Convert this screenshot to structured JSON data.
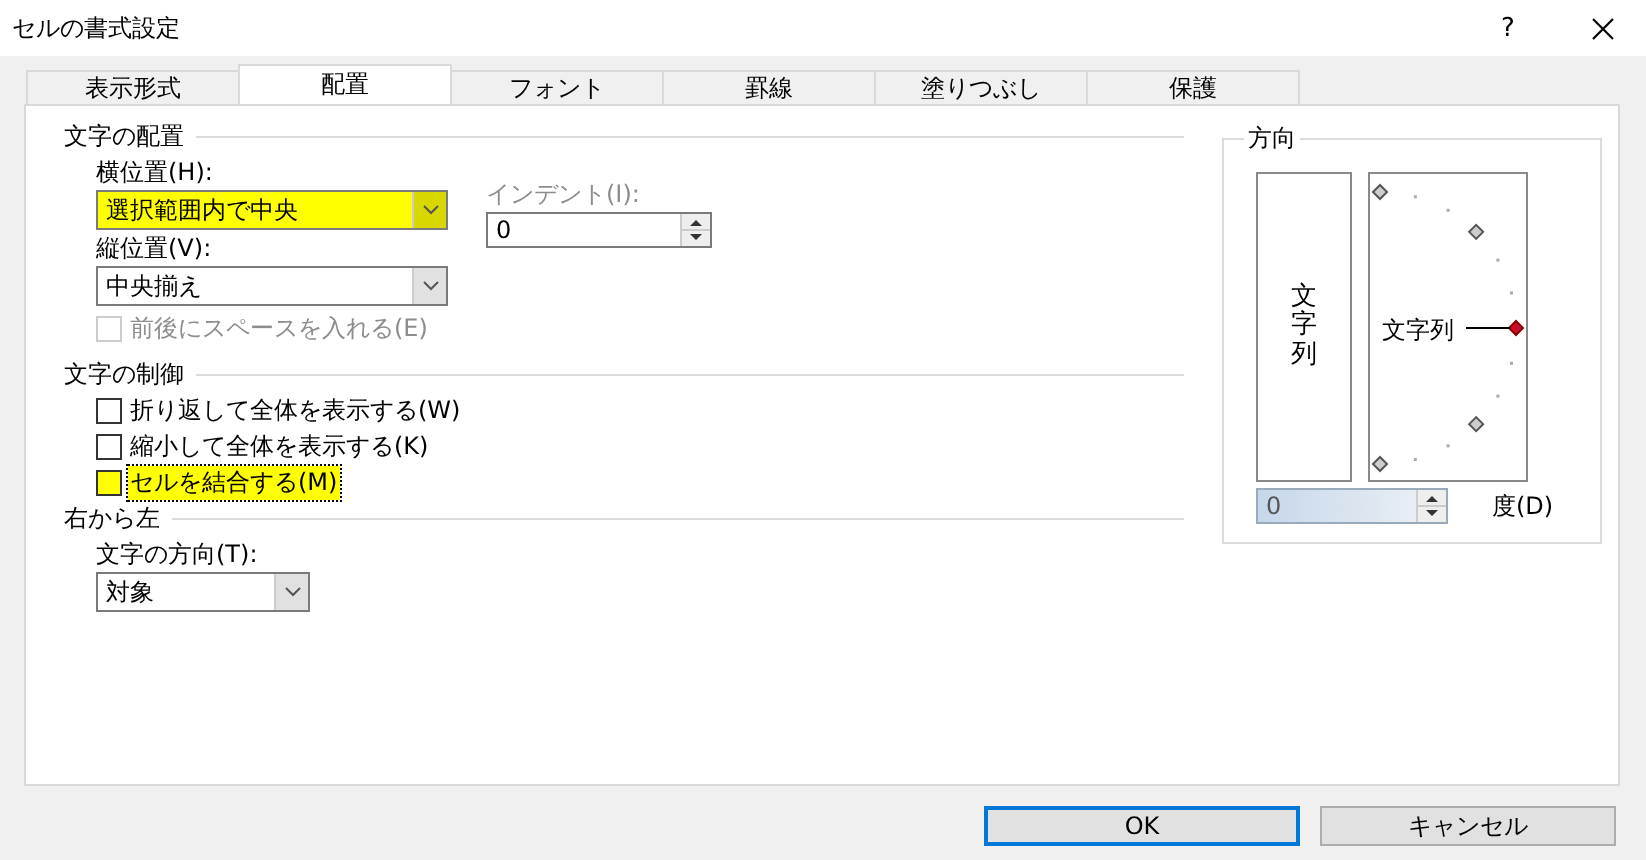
{
  "window": {
    "title": "セルの書式設定",
    "help": "?"
  },
  "tabs": [
    {
      "label": "表示形式",
      "selected": false
    },
    {
      "label": "配置",
      "selected": true
    },
    {
      "label": "フォント",
      "selected": false
    },
    {
      "label": "罫線",
      "selected": false
    },
    {
      "label": "塗りつぶし",
      "selected": false
    },
    {
      "label": "保護",
      "selected": false
    }
  ],
  "alignment": {
    "heading": "文字の配置",
    "horizontal": {
      "label": "横位置(H):",
      "value": "選択範囲内で中央",
      "highlighted": true
    },
    "indent": {
      "label": "インデント(I):",
      "value": "0",
      "disabled": true
    },
    "vertical": {
      "label": "縦位置(V):",
      "value": "中央揃え",
      "highlighted": false
    },
    "distributed": {
      "label": "前後にスペースを入れる(E)",
      "checked": false,
      "disabled": true
    }
  },
  "text_control": {
    "heading": "文字の制御",
    "options": [
      {
        "label": "折り返して全体を表示する(W)",
        "checked": false,
        "highlighted": false
      },
      {
        "label": "縮小して全体を表示する(K)",
        "checked": false,
        "highlighted": false
      },
      {
        "label": "セルを結合する(M)",
        "checked": false,
        "highlighted": true
      }
    ]
  },
  "rtl": {
    "heading": "右から左",
    "direction": {
      "label": "文字の方向(T):",
      "value": "対象",
      "highlighted": false
    }
  },
  "orientation": {
    "heading": "方向",
    "vertical_text": "文字列",
    "dial_text": "文字列",
    "degrees": {
      "value": "0",
      "label": "度(D)"
    }
  },
  "buttons": [
    {
      "label": "OK",
      "default": true
    },
    {
      "label": "キャンセル",
      "default": false
    }
  ]
}
